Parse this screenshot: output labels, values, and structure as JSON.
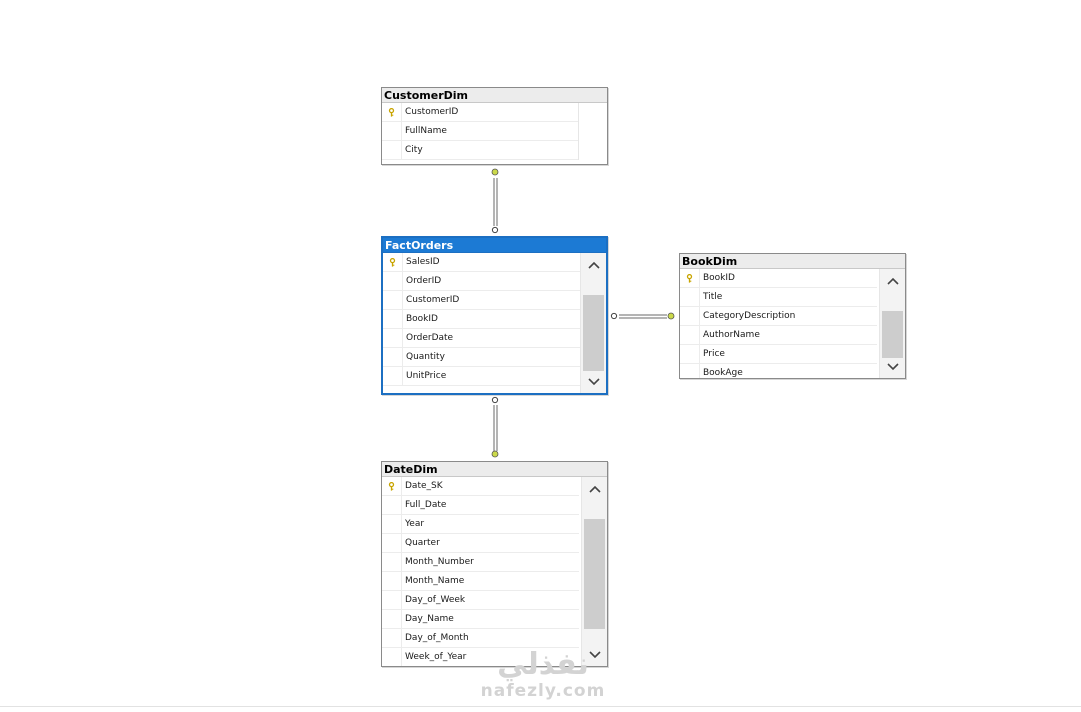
{
  "tables": {
    "customer": {
      "title": "CustomerDim",
      "rows": [
        "CustomerID",
        "FullName",
        "City"
      ],
      "key_row": 0
    },
    "fact": {
      "title": "FactOrders",
      "rows": [
        "SalesID",
        "OrderID",
        "CustomerID",
        "BookID",
        "OrderDate",
        "Quantity",
        "UnitPrice"
      ],
      "key_row": 0,
      "selected": true
    },
    "book": {
      "title": "BookDim",
      "rows": [
        "BookID",
        "Title",
        "CategoryDescription",
        "AuthorName",
        "Price",
        "BookAge"
      ],
      "key_row": 0
    },
    "date": {
      "title": "DateDim",
      "rows": [
        "Date_SK",
        "Full_Date",
        "Year",
        "Quarter",
        "Month_Number",
        "Month_Name",
        "Day_of_Week",
        "Day_Name",
        "Day_of_Month",
        "Week_of_Year"
      ],
      "key_row": 0
    }
  },
  "relationships": [
    {
      "from": "FactOrders",
      "to": "CustomerDim"
    },
    {
      "from": "FactOrders",
      "to": "BookDim"
    },
    {
      "from": "FactOrders",
      "to": "DateDim"
    }
  ],
  "watermark": {
    "logo": "نفذلي",
    "url": "nafezly.com"
  },
  "icons": {
    "primary_key": "key-icon",
    "scroll_up": "chevron-up-icon",
    "scroll_down": "chevron-down-icon"
  },
  "colors": {
    "selected_title": "#1c7ad4",
    "title_bar": "#ececec",
    "key": "#c8a400",
    "connector_end": "#cbd94a"
  }
}
